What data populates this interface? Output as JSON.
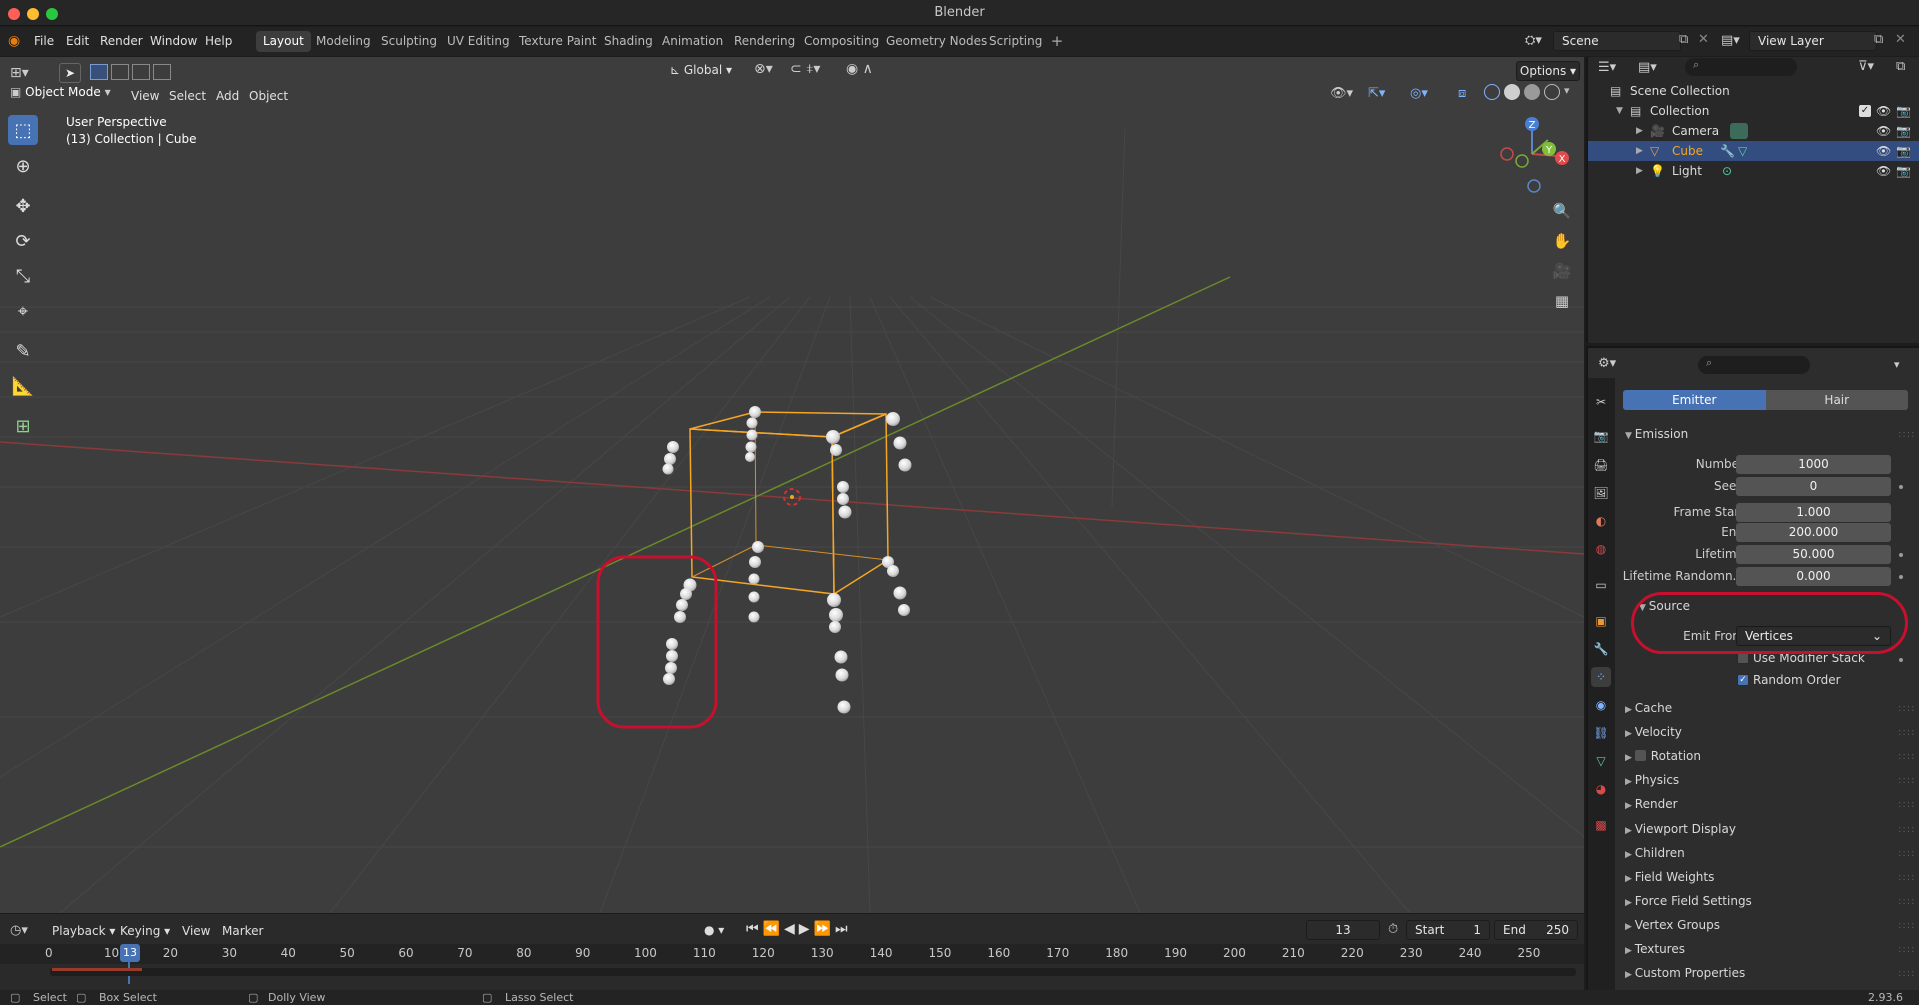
{
  "window": {
    "title": "Blender"
  },
  "menus": [
    "File",
    "Edit",
    "Render",
    "Window",
    "Help"
  ],
  "workspaces": [
    "Layout",
    "Modeling",
    "Sculpting",
    "UV Editing",
    "Texture Paint",
    "Shading",
    "Animation",
    "Rendering",
    "Compositing",
    "Geometry Nodes",
    "Scripting"
  ],
  "active_workspace": "Layout",
  "scene": {
    "name": "Scene",
    "view_layer": "View Layer"
  },
  "viewport": {
    "mode": "Object Mode",
    "header_menus": [
      "View",
      "Select",
      "Add",
      "Object"
    ],
    "orientation": "Global",
    "options_label": "Options",
    "info_line1": "User Perspective",
    "info_line2": "(13) Collection | Cube",
    "gizmo_axes": {
      "x": "X",
      "y": "Y",
      "z": "Z"
    }
  },
  "outliner": {
    "root": "Scene Collection",
    "collection": "Collection",
    "items": [
      {
        "name": "Camera",
        "selected": false,
        "icon_color": "#e6a24a"
      },
      {
        "name": "Cube",
        "selected": true,
        "icon_color": "#e6a24a"
      },
      {
        "name": "Light",
        "selected": false,
        "icon_color": "#e6a24a"
      }
    ]
  },
  "properties": {
    "type_tabs": {
      "emitter": "Emitter",
      "hair": "Hair",
      "active": "Emitter"
    },
    "emission": {
      "title": "Emission",
      "number_label": "Number",
      "number": "1000",
      "seed_label": "Seed",
      "seed": "0",
      "frame_start_label": "Frame Start",
      "frame_start": "1.000",
      "end_label": "End",
      "end": "200.000",
      "lifetime_label": "Lifetime",
      "lifetime": "50.000",
      "lifetime_random_label": "Lifetime Randomn...",
      "lifetime_random": "0.000"
    },
    "source": {
      "title": "Source",
      "emit_from_label": "Emit From",
      "emit_from": "Vertices",
      "use_modifier_stack": "Use Modifier Stack",
      "random_order": "Random Order"
    },
    "panels": [
      "Cache",
      "Velocity",
      "Rotation",
      "Physics",
      "Render",
      "Viewport Display",
      "Children",
      "Field Weights",
      "Force Field Settings",
      "Vertex Groups",
      "Textures",
      "Custom Properties"
    ]
  },
  "timeline": {
    "menus": [
      "Playback",
      "Keying",
      "View",
      "Marker"
    ],
    "current_frame": "13",
    "start_label": "Start",
    "start": "1",
    "end_label": "End",
    "end": "250",
    "ruler": [
      "0",
      "10",
      "20",
      "30",
      "40",
      "50",
      "60",
      "70",
      "80",
      "90",
      "100",
      "110",
      "120",
      "130",
      "140",
      "150",
      "160",
      "170",
      "180",
      "190",
      "200",
      "210",
      "220",
      "230",
      "240",
      "250"
    ]
  },
  "statusbar": {
    "select": "Select",
    "box_select": "Box Select",
    "dolly_view": "Dolly View",
    "lasso_select": "Lasso Select",
    "version": "2.93.6"
  },
  "colors": {
    "accent": "#4772b3",
    "highlight": "#c8102e",
    "selection": "#f5a623"
  }
}
